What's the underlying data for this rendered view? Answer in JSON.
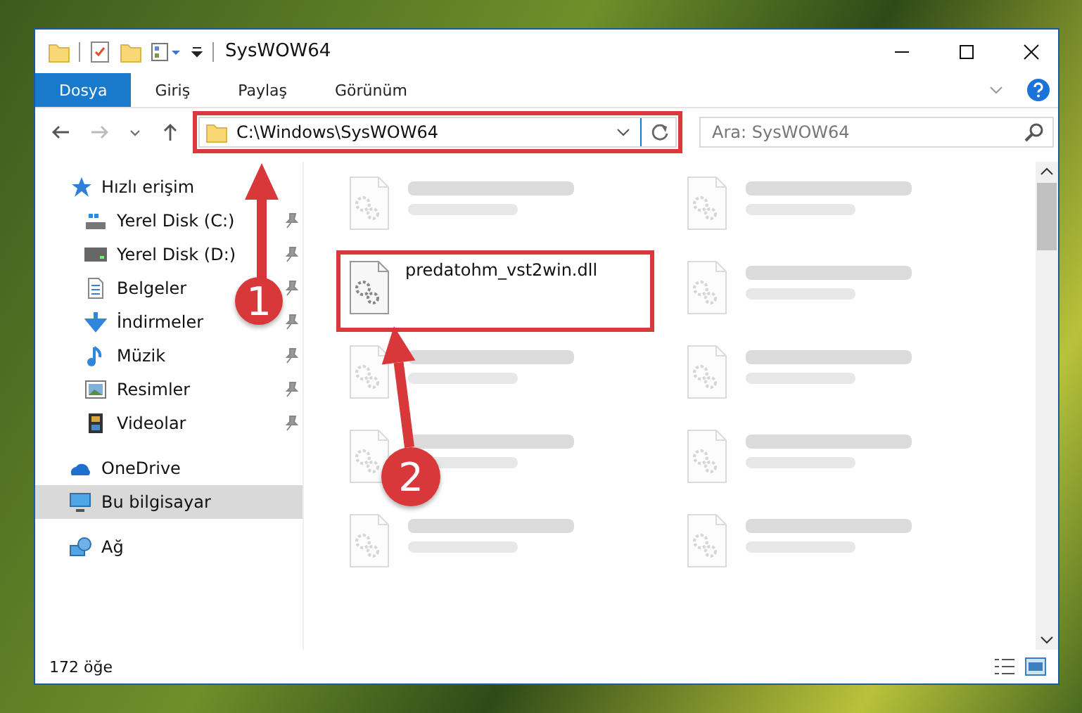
{
  "window": {
    "title": "SysWOW64"
  },
  "ribbon_tabs": [
    {
      "label": "Dosya",
      "selected": true
    },
    {
      "label": "Giriş",
      "selected": false
    },
    {
      "label": "Paylaş",
      "selected": false
    },
    {
      "label": "Görünüm",
      "selected": false
    }
  ],
  "address_bar": {
    "value": "C:\\Windows\\SysWOW64",
    "highlighted": true
  },
  "search": {
    "placeholder": "Ara: SysWOW64"
  },
  "sidebar": {
    "items": [
      {
        "label": "Hızlı erişim",
        "kind": "quick",
        "selected": false,
        "children": [
          {
            "label": "Yerel Disk (C:)",
            "kind": "disk-c",
            "pinned": true
          },
          {
            "label": "Yerel Disk (D:)",
            "kind": "disk",
            "pinned": true
          },
          {
            "label": "Belgeler",
            "kind": "docs",
            "pinned": true
          },
          {
            "label": "İndirmeler",
            "kind": "download",
            "pinned": true
          },
          {
            "label": "Müzik",
            "kind": "music",
            "pinned": true
          },
          {
            "label": "Resimler",
            "kind": "pictures",
            "pinned": true
          },
          {
            "label": "Videolar",
            "kind": "videos",
            "pinned": true
          }
        ]
      },
      {
        "label": "OneDrive",
        "kind": "cloud",
        "selected": false
      },
      {
        "label": "Bu bilgisayar",
        "kind": "pc",
        "selected": true
      },
      {
        "label": "Ağ",
        "kind": "network",
        "selected": false
      }
    ]
  },
  "files": [
    {
      "kind": "blurred"
    },
    {
      "kind": "blurred"
    },
    {
      "kind": "file",
      "name": "predatohm_vst2win.dll",
      "highlighted": true
    },
    {
      "kind": "blurred"
    },
    {
      "kind": "blurred"
    },
    {
      "kind": "blurred"
    },
    {
      "kind": "blurred"
    },
    {
      "kind": "blurred"
    },
    {
      "kind": "blurred"
    },
    {
      "kind": "blurred"
    }
  ],
  "status_bar": {
    "count": "172 öğe"
  },
  "annotations": [
    {
      "label": "1"
    },
    {
      "label": "2"
    }
  ]
}
